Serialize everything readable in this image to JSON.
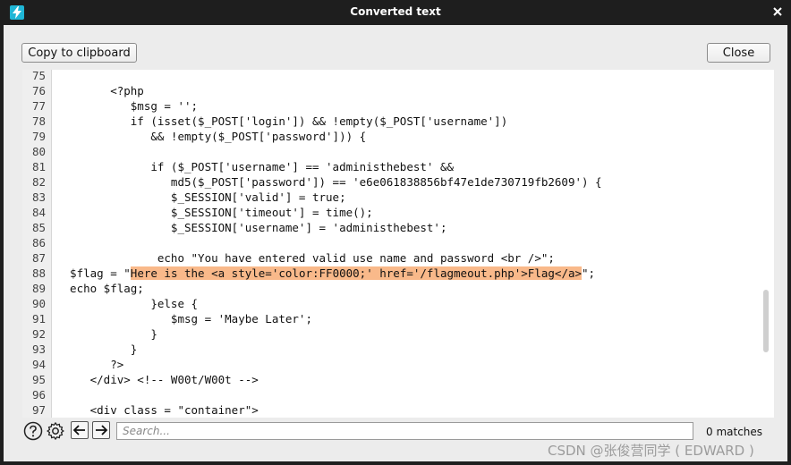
{
  "window": {
    "title": "Converted text"
  },
  "toolbar": {
    "copy_label": "Copy to clipboard",
    "close_label": "Close"
  },
  "editor": {
    "lines": [
      {
        "n": "75",
        "text": ""
      },
      {
        "n": "76",
        "text": "        <?php"
      },
      {
        "n": "77",
        "text": "           $msg = '';"
      },
      {
        "n": "78",
        "text": "           if (isset($_POST['login']) && !empty($_POST['username'])"
      },
      {
        "n": "79",
        "text": "              && !empty($_POST['password'])) {"
      },
      {
        "n": "80",
        "text": ""
      },
      {
        "n": "81",
        "text": "              if ($_POST['username'] == 'administhebest' &&"
      },
      {
        "n": "82",
        "text": "                 md5($_POST['password']) == 'e6e061838856bf47e1de730719fb2609') {"
      },
      {
        "n": "83",
        "text": "                 $_SESSION['valid'] = true;"
      },
      {
        "n": "84",
        "text": "                 $_SESSION['timeout'] = time();"
      },
      {
        "n": "85",
        "text": "                 $_SESSION['username'] = 'administhebest';"
      },
      {
        "n": "86",
        "text": ""
      },
      {
        "n": "87",
        "text": "               echo \"You have entered valid use name and password <br />\";"
      },
      {
        "n": "88",
        "text_pre": "  $flag = \"",
        "text_hl": "Here is the <a style='color:FF0000;' href='/flagmeout.php'>Flag</a>",
        "text_post": "\";"
      },
      {
        "n": "89",
        "text": "  echo $flag;"
      },
      {
        "n": "90",
        "text": "              }else {"
      },
      {
        "n": "91",
        "text": "                 $msg = 'Maybe Later';"
      },
      {
        "n": "92",
        "text": "              }"
      },
      {
        "n": "93",
        "text": "           }"
      },
      {
        "n": "94",
        "text": "        ?>"
      },
      {
        "n": "95",
        "text": "     </div> <!-- W00t/W00t -->"
      },
      {
        "n": "96",
        "text": ""
      },
      {
        "n": "97",
        "text": "     <div class = \"container\">"
      }
    ]
  },
  "search": {
    "placeholder": "Search...",
    "matches": "0 matches"
  },
  "icons": {
    "help": "help-icon",
    "settings": "settings-gear-icon",
    "prev": "arrow-left-icon",
    "next": "arrow-right-icon"
  },
  "watermark": "CSDN @张俊营同学 ( EDWARD )",
  "colors": {
    "highlight": "#f9b98a",
    "titlebar": "#1e1e1e",
    "app_icon": "#1fb6d6"
  }
}
